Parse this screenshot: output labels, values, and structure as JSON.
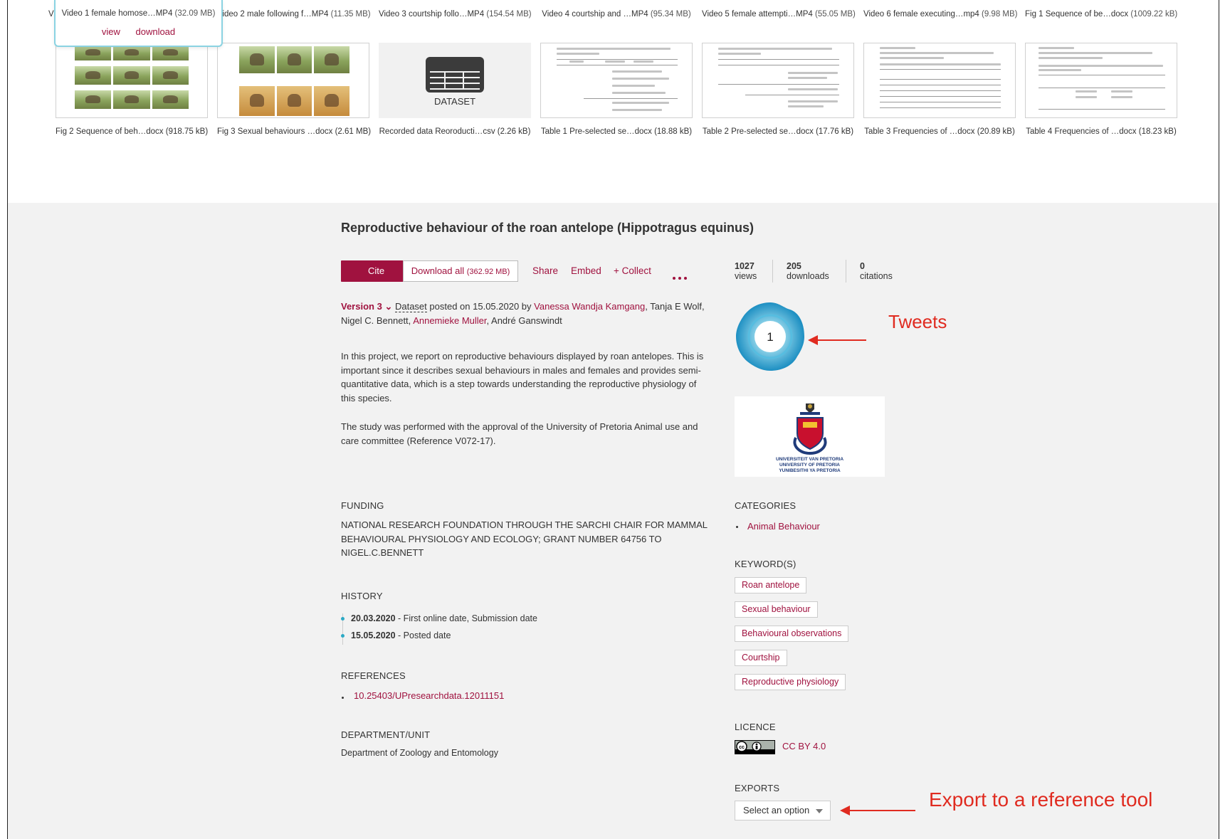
{
  "files_row1": [
    {
      "name": "Video 1 female homose…",
      "ext": "MP4",
      "size": "(32.09 MB)"
    },
    {
      "name": "Video 2 male following f…",
      "ext": "MP4",
      "size": "(11.35 MB)"
    },
    {
      "name": "Video 3 courtship follo…",
      "ext": "MP4",
      "size": "(154.54 MB)"
    },
    {
      "name": "Video 4 courtship and …",
      "ext": "MP4",
      "size": "(95.34 MB)"
    },
    {
      "name": "Video 5 female attempti…",
      "ext": "MP4",
      "size": "(55.05 MB)"
    },
    {
      "name": "Video 6 female executing…",
      "ext": "mp4",
      "size": "(9.98 MB)"
    },
    {
      "name": "Fig 1 Sequence of be…",
      "ext": "docx",
      "size": "(1009.22 kB)"
    }
  ],
  "hover_actions": {
    "view": "view",
    "download": "download"
  },
  "files_row2": [
    {
      "name": "Fig 2 Sequence of beh…",
      "ext": "docx",
      "size": "(918.75 kB)"
    },
    {
      "name": "Fig 3 Sexual behaviours …",
      "ext": "docx",
      "size": "(2.61 MB)"
    },
    {
      "name": "Recorded data Reoroducti…",
      "ext": "csv",
      "size": "(2.26 kB)"
    },
    {
      "name": "Table 1 Pre-selected se…",
      "ext": "docx",
      "size": "(18.88 kB)"
    },
    {
      "name": "Table 2 Pre-selected se…",
      "ext": "docx",
      "size": "(17.76 kB)"
    },
    {
      "name": "Table 3 Frequencies of …",
      "ext": "docx",
      "size": "(20.89 kB)"
    },
    {
      "name": "Table 4 Frequencies of …",
      "ext": "docx",
      "size": "(18.23 kB)"
    }
  ],
  "dataset_thumb_label": "DATASET",
  "article": {
    "title": "Reproductive behaviour of the roan antelope (Hippotragus equinus)",
    "cite": "Cite",
    "download_all": "Download all",
    "download_size": "(362.92 MB)",
    "share": "Share",
    "embed": "Embed",
    "collect": "+ Collect",
    "version": "Version 3",
    "item_type": "Dataset",
    "posted_text": "posted on 15.05.2020 by",
    "author1": "Vanessa Wandja Kamgang",
    "author2": "Tanja E Wolf,",
    "author3": "Nigel C. Bennett,",
    "author4": "Annemieke Muller",
    "author5": "André Ganswindt",
    "desc1": "In this project, we report on reproductive behaviours displayed by roan antelopes. This is important since it describes sexual behaviours in males and females and provides semi-quantitative data, which is a step towards understanding the reproductive physiology of this species.",
    "desc2": "The study was performed with the approval of the University of Pretoria Animal use and care committee (Reference V072-17).",
    "funding_h": "FUNDING",
    "funding": "NATIONAL RESEARCH FOUNDATION THROUGH THE SARCHI CHAIR FOR MAMMAL BEHAVIOURAL PHYSIOLOGY AND ECOLOGY; GRANT NUMBER 64756 TO NIGEL.C.BENNETT",
    "history_h": "HISTORY",
    "history": [
      {
        "date": "20.03.2020",
        "label": "- First online date, Submission date"
      },
      {
        "date": "15.05.2020",
        "label": "- Posted date"
      }
    ],
    "references_h": "REFERENCES",
    "reference": "10.25403/UPresearchdata.12011151",
    "department_h": "DEPARTMENT/UNIT",
    "department": "Department of Zoology and Entomology"
  },
  "stats": [
    {
      "value": "1027",
      "label": "views"
    },
    {
      "value": "205",
      "label": "downloads"
    },
    {
      "value": "0",
      "label": "citations"
    }
  ],
  "altmetric_score": "1",
  "annotation_tweets": "Tweets",
  "university_lines": [
    "UNIVERSITEIT VAN PRETORIA",
    "UNIVERSITY OF PRETORIA",
    "YUNIBESITHI YA PRETORIA"
  ],
  "categories_h": "CATEGORIES",
  "category": "Animal Behaviour",
  "keywords_h": "KEYWORD(S)",
  "keywords": [
    "Roan antelope",
    "Sexual behaviour",
    "Behavioural observations",
    "Courtship",
    "Reproductive physiology"
  ],
  "licence_h": "LICENCE",
  "licence": "CC BY 4.0",
  "exports_h": "EXPORTS",
  "export_select": "Select an option",
  "annotation_export": "Export to a reference tool",
  "colors": {
    "accent": "#a0123f",
    "annotation": "#e02b20",
    "altmetric": "#2ba9c5"
  }
}
